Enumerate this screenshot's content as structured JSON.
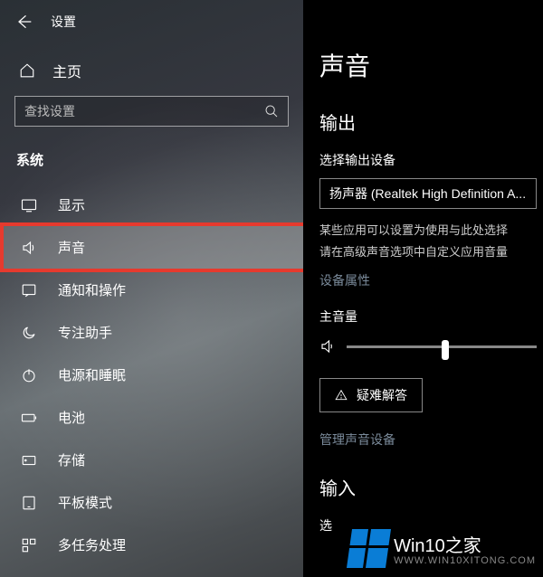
{
  "header": {
    "title": "设置"
  },
  "sidebar": {
    "home_label": "主页",
    "search_placeholder": "查找设置",
    "section_title": "系统",
    "items": [
      {
        "label": "显示"
      },
      {
        "label": "声音"
      },
      {
        "label": "通知和操作"
      },
      {
        "label": "专注助手"
      },
      {
        "label": "电源和睡眠"
      },
      {
        "label": "电池"
      },
      {
        "label": "存储"
      },
      {
        "label": "平板模式"
      },
      {
        "label": "多任务处理"
      }
    ]
  },
  "content": {
    "page_title": "声音",
    "output_title": "输出",
    "output_device_label": "选择输出设备",
    "output_device_value": "扬声器 (Realtek High Definition A...",
    "help_line1": "某些应用可以设置为使用与此处选择",
    "help_line2": "请在高级声音选项中自定义应用音量",
    "device_properties": "设备属性",
    "master_volume_label": "主音量",
    "volume_percent": 50,
    "troubleshoot_label": "疑难解答",
    "manage_devices": "管理声音设备",
    "input_title": "输入",
    "input_prefix": "选"
  },
  "watermark": {
    "brand": "Win10",
    "suffix": "之家",
    "url": "WWW.WIN10XITONG.COM"
  }
}
